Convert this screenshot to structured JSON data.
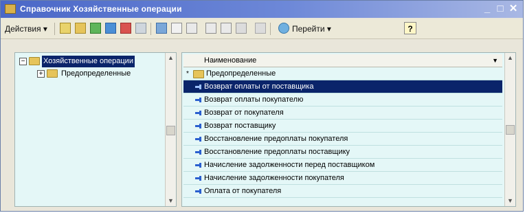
{
  "window": {
    "title": "Справочник Хозяйственные операции",
    "minimize": "_",
    "maximize": "□",
    "close": "✕"
  },
  "toolbar": {
    "actions_label": "Действия",
    "goto_label": "Перейти",
    "help_label": "?"
  },
  "tree": {
    "items": [
      {
        "label": "Хозяйственные операции",
        "expander": "−"
      },
      {
        "label": "Предопределенные",
        "expander": "+"
      }
    ]
  },
  "list": {
    "header": "Наименование",
    "rows": [
      {
        "label": "Предопределенные",
        "type": "folder",
        "marker": "*"
      },
      {
        "label": "Возврат оплаты от поставщика",
        "type": "item",
        "selected": true
      },
      {
        "label": "Возврат оплаты покупателю",
        "type": "item"
      },
      {
        "label": "Возврат от покупателя",
        "type": "item"
      },
      {
        "label": "Возврат поставщику",
        "type": "item"
      },
      {
        "label": "Восстановление предоплаты покупателя",
        "type": "item"
      },
      {
        "label": "Восстановление предоплаты поставщику",
        "type": "item"
      },
      {
        "label": "Начисление задолженности перед поставщиком",
        "type": "item"
      },
      {
        "label": "Начисление задолженности покупателя",
        "type": "item"
      },
      {
        "label": "Оплата от покупателя",
        "type": "item"
      }
    ]
  },
  "colors": {
    "selection": "#0a246a",
    "panel_background": "#e4f7f7",
    "titlebar": "#4a67c7"
  }
}
